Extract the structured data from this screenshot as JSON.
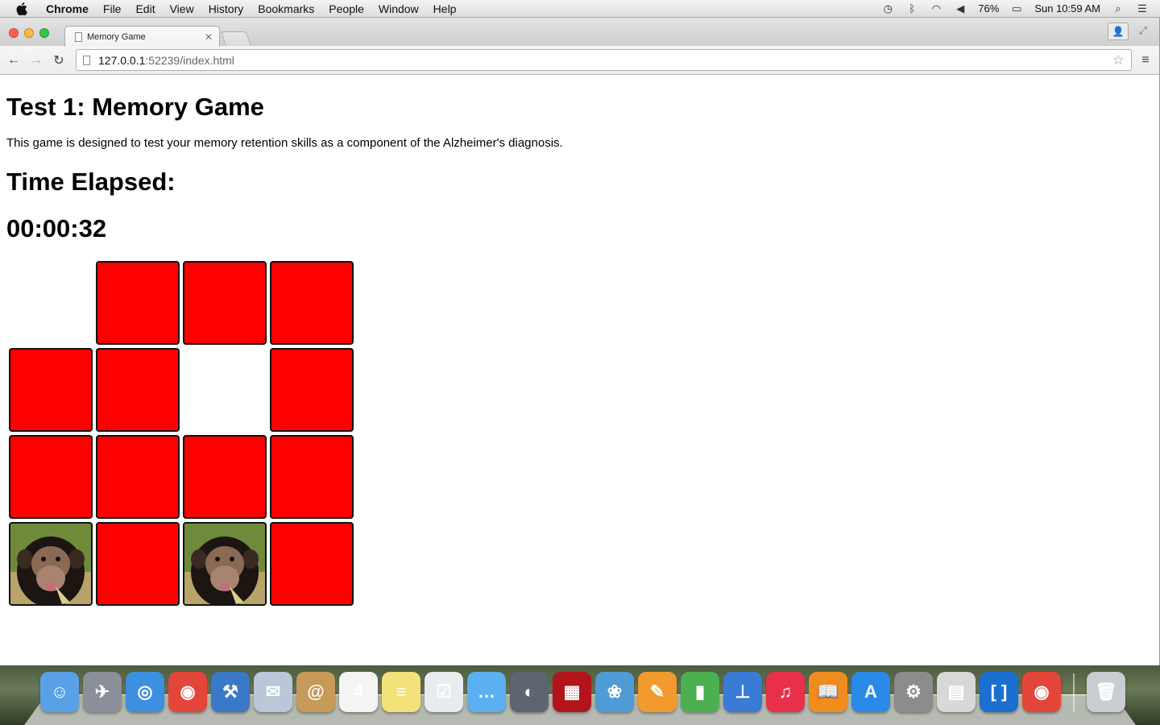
{
  "menubar": {
    "app_name": "Chrome",
    "items": [
      "File",
      "Edit",
      "View",
      "History",
      "Bookmarks",
      "People",
      "Window",
      "Help"
    ],
    "battery": "76%",
    "clock": "Sun 10:59 AM"
  },
  "browser": {
    "tab_title": "Memory Game",
    "url_host": "127.0.0.1",
    "url_path": ":52239/index.html"
  },
  "page": {
    "heading": "Test 1: Memory Game",
    "description": "This game is designed to test your memory retention skills as a component of the Alzheimer's diagnosis.",
    "elapsed_label": "Time Elapsed:",
    "elapsed_value": "00:00:32"
  },
  "board": {
    "rows": [
      [
        "empty",
        "hidden",
        "hidden",
        "hidden"
      ],
      [
        "hidden",
        "hidden",
        "empty",
        "hidden"
      ],
      [
        "hidden",
        "hidden",
        "hidden",
        "hidden"
      ],
      [
        "chimpanzee",
        "hidden",
        "chimpanzee",
        "hidden"
      ]
    ],
    "hidden_color": "#ff0000"
  },
  "dock": {
    "apps": [
      {
        "name": "finder-icon",
        "color": "#5aa0e6",
        "glyph": "☺"
      },
      {
        "name": "launchpad-icon",
        "color": "#8a8f98",
        "glyph": "✈"
      },
      {
        "name": "safari-icon",
        "color": "#3d8fe0",
        "glyph": "◎"
      },
      {
        "name": "chrome-icon",
        "color": "#e4453a",
        "glyph": "◉"
      },
      {
        "name": "xcode-icon",
        "color": "#3a78c8",
        "glyph": "⚒"
      },
      {
        "name": "mail-icon",
        "color": "#b9c7d9",
        "glyph": "✉"
      },
      {
        "name": "contacts-icon",
        "color": "#c79a5a",
        "glyph": "@"
      },
      {
        "name": "calendar-icon",
        "color": "#f4f4f4",
        "glyph": "4"
      },
      {
        "name": "notes-icon",
        "color": "#f3e27a",
        "glyph": "≡"
      },
      {
        "name": "reminders-icon",
        "color": "#e8ecef",
        "glyph": "☑"
      },
      {
        "name": "messages-icon",
        "color": "#5ab0f0",
        "glyph": "…"
      },
      {
        "name": "facetime-icon",
        "color": "#5d6670",
        "glyph": "◐"
      },
      {
        "name": "photo-booth-icon",
        "color": "#b3141c",
        "glyph": "▦"
      },
      {
        "name": "iphoto-icon",
        "color": "#4f9bd5",
        "glyph": "❀"
      },
      {
        "name": "pages-icon",
        "color": "#f29a2e",
        "glyph": "✎"
      },
      {
        "name": "numbers-icon",
        "color": "#4cb050",
        "glyph": "▮"
      },
      {
        "name": "keynote-icon",
        "color": "#3a7bd5",
        "glyph": "⊥"
      },
      {
        "name": "itunes-icon",
        "color": "#e8304a",
        "glyph": "♫"
      },
      {
        "name": "ibooks-icon",
        "color": "#f08c1e",
        "glyph": "📖"
      },
      {
        "name": "app-store-icon",
        "color": "#2a8ae8",
        "glyph": "A"
      },
      {
        "name": "system-preferences-icon",
        "color": "#8c8c8c",
        "glyph": "⚙"
      },
      {
        "name": "calculator-icon",
        "color": "#d8d8d8",
        "glyph": "▤"
      },
      {
        "name": "brackets-icon",
        "color": "#1a6fd1",
        "glyph": "[ ]"
      },
      {
        "name": "chrome-canary-icon",
        "color": "#e4453a",
        "glyph": "◉"
      }
    ],
    "trash": {
      "name": "trash-icon",
      "color": "#c9ccd0",
      "glyph": "🗑"
    }
  }
}
